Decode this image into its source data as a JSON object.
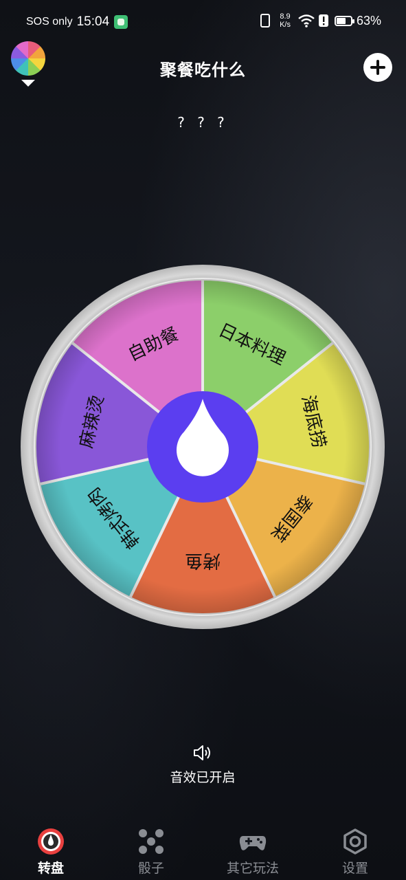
{
  "status_bar": {
    "carrier": "SOS only",
    "time": "15:04",
    "speed_value": "8.9",
    "speed_unit": "K/s",
    "battery_percent": "63%",
    "battery_level": 0.63
  },
  "header": {
    "title": "聚餐吃什么",
    "theme_icon": "color-wheel-icon",
    "add_icon": "plus-icon"
  },
  "result": {
    "text": "? ? ?"
  },
  "wheel": {
    "segments": [
      {
        "label": "日本料理",
        "color": "#8ccf6a"
      },
      {
        "label": "海底捞",
        "color": "#e0dd55"
      },
      {
        "label": "泰国菜",
        "color": "#ecb24a"
      },
      {
        "label": "烤鱼",
        "color": "#e36c43"
      },
      {
        "label": "韩式烤肉",
        "color": "#58c2c5"
      },
      {
        "label": "麻辣烫",
        "color": "#8957d8"
      },
      {
        "label": "自助餐",
        "color": "#dc72cb"
      }
    ],
    "hub_color": "#5b3ef0",
    "rim_color": "#c9c9c9"
  },
  "sound": {
    "label": "音效已开启",
    "icon": "speaker-icon"
  },
  "tabs": [
    {
      "label": "转盘",
      "icon": "wheel-icon",
      "active": true
    },
    {
      "label": "骰子",
      "icon": "dice-icon",
      "active": false
    },
    {
      "label": "其它玩法",
      "icon": "gamepad-icon",
      "active": false
    },
    {
      "label": "设置",
      "icon": "settings-icon",
      "active": false
    }
  ]
}
